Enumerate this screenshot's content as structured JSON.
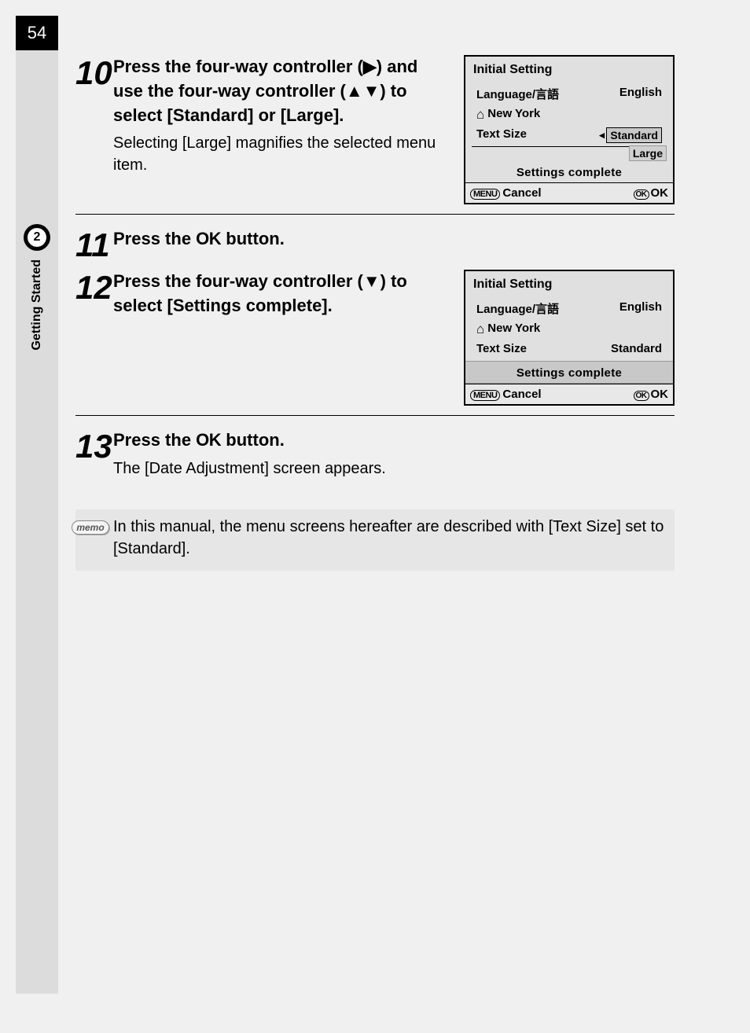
{
  "page_number": "54",
  "chapter_number": "2",
  "chapter_title": "Getting Started",
  "steps": {
    "s10": {
      "num": "10",
      "title": "Press the four-way controller (▶) and use the four-way controller (▲▼) to select [Standard] or [Large].",
      "desc": "Selecting [Large] magnifies the selected menu item."
    },
    "s11": {
      "num": "11",
      "title_prefix": "Press the ",
      "ok": "OK",
      "title_suffix": " button."
    },
    "s12": {
      "num": "12",
      "title": "Press the four-way controller (▼) to select [Settings complete]."
    },
    "s13": {
      "num": "13",
      "title_prefix": "Press the ",
      "ok": "OK",
      "title_suffix": " button.",
      "desc": "The [Date Adjustment] screen appears."
    }
  },
  "lcd1": {
    "title": "Initial Setting",
    "language_label": "Language/言語",
    "language_value": "English",
    "city": "New York",
    "textsize_label": "Text Size",
    "opt_standard": "Standard",
    "opt_large": "Large",
    "settings_complete": "Settings complete",
    "menu_label": "MENU",
    "cancel": "Cancel",
    "ok_pill": "OK",
    "ok": "OK"
  },
  "lcd2": {
    "title": "Initial Setting",
    "language_label": "Language/言語",
    "language_value": "English",
    "city": "New York",
    "textsize_label": "Text Size",
    "textsize_value": "Standard",
    "settings_complete": "Settings complete",
    "menu_label": "MENU",
    "cancel": "Cancel",
    "ok_pill": "OK",
    "ok": "OK"
  },
  "memo": {
    "icon": "memo",
    "text": "In this manual, the menu screens hereafter are described with [Text Size] set to [Standard]."
  }
}
